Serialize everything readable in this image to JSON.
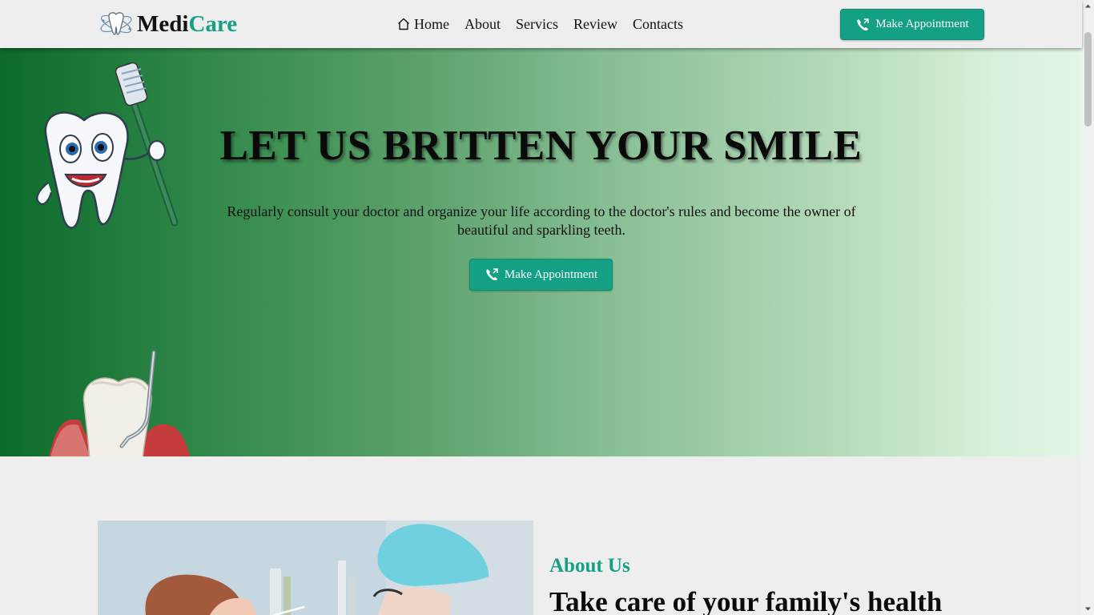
{
  "brand": {
    "part1": "Medi",
    "part2": "Care",
    "accent_color": "#14a085"
  },
  "nav": {
    "items": [
      {
        "label": "Home",
        "icon": "home-icon"
      },
      {
        "label": "About"
      },
      {
        "label": "Servics"
      },
      {
        "label": "Review"
      },
      {
        "label": "Contacts"
      }
    ],
    "cta_label": "Make Appointment",
    "cta_icon": "phone-icon"
  },
  "hero": {
    "title": "LET US BRITTEN YOUR SMILE",
    "text": "Regularly consult your doctor and organize your life according to the doctor's rules and become the owner of beautiful and sparkling teeth.",
    "cta_label": "Make Appointment",
    "gradient_start": "#0b6a2a",
    "gradient_end": "#e4f6e6"
  },
  "about": {
    "eyebrow": "About Us",
    "title": "Take care of your family's health"
  }
}
